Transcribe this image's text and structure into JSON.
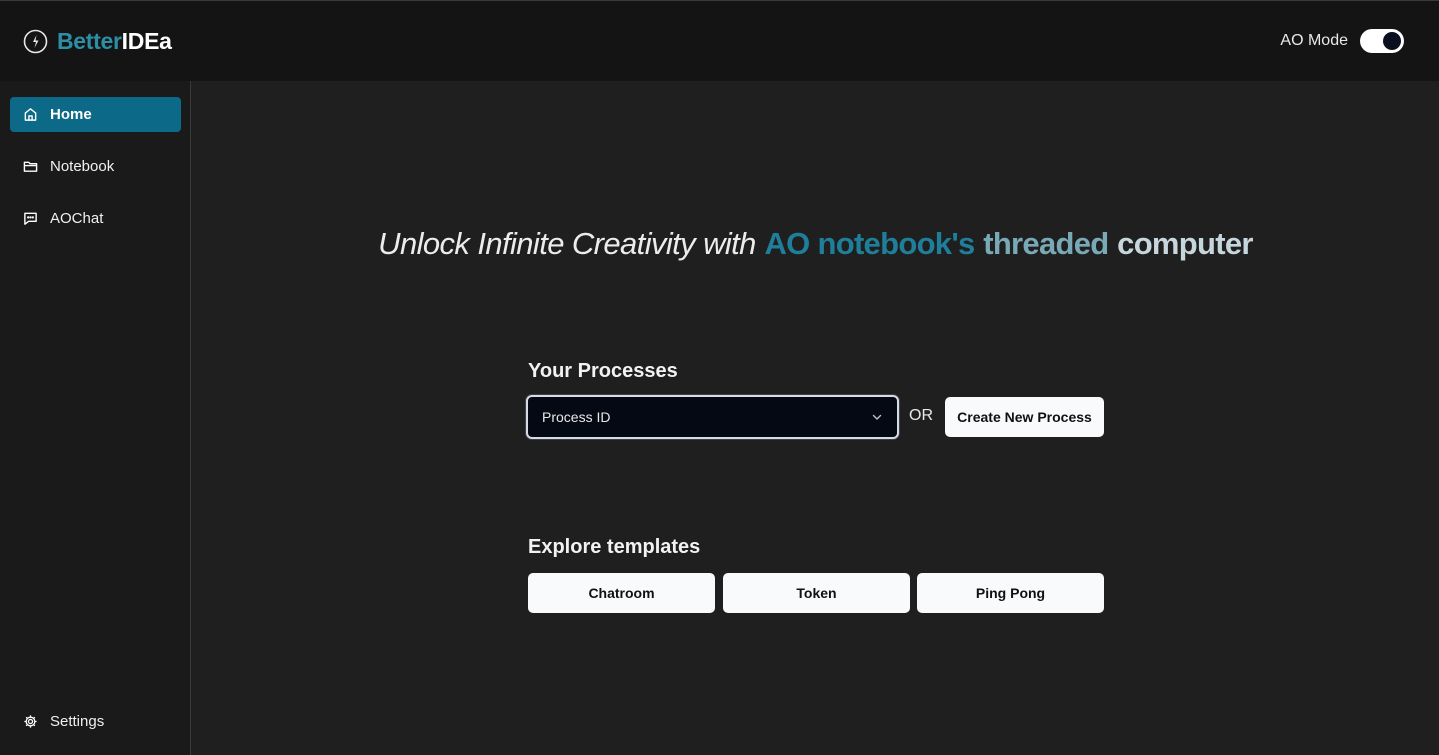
{
  "header": {
    "brand_part1": "Better",
    "brand_part2": "IDEa",
    "mode_label": "AO Mode",
    "mode_enabled": true
  },
  "sidebar": {
    "items": [
      {
        "label": "Home",
        "icon": "home-icon",
        "active": true
      },
      {
        "label": "Notebook",
        "icon": "folder-icon",
        "active": false
      },
      {
        "label": "AOChat",
        "icon": "chat-icon",
        "active": false
      }
    ],
    "settings_label": "Settings"
  },
  "hero": {
    "part1": "Unlock Infinite Creativity with",
    "part2": "AO notebook's",
    "part3": "threaded",
    "part4": "computer"
  },
  "processes": {
    "title": "Your Processes",
    "select_placeholder": "Process ID",
    "or_label": "OR",
    "create_label": "Create New Process"
  },
  "templates": {
    "title": "Explore templates",
    "items": [
      "Chatroom",
      "Token",
      "Ping Pong"
    ]
  },
  "colors": {
    "accent": "#0c6a88",
    "brand_teal": "#2d8fa6",
    "background": "#1f1f1f"
  }
}
